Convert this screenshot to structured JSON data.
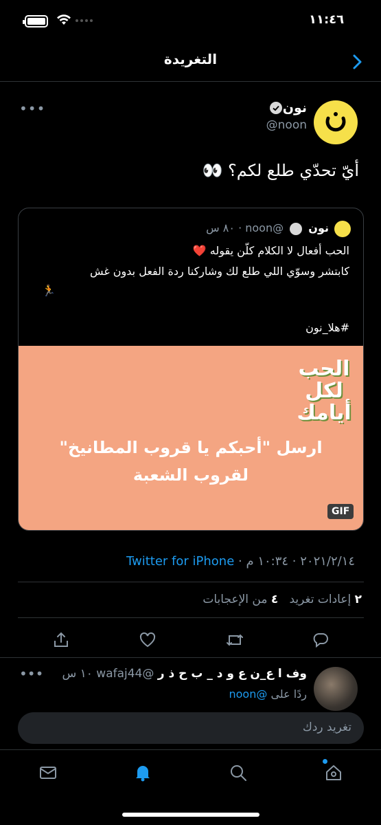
{
  "status_bar": {
    "time": "١١:٤٦"
  },
  "header": {
    "title": "التغريدة"
  },
  "tweet": {
    "author_name": "نون",
    "author_handle": "@noon",
    "text": "أيّ تحدّي طلع لكم؟ 👀",
    "quoted": {
      "author_name": "نون",
      "handle_time": "@noon · ٨٠ س",
      "line1": "الحب أفعال لا الكلام كلّن يقوله ❤️",
      "line2": "كابتشر وسوّي اللي طلع لك وشاركنا ردة الفعل بدون غش",
      "line3": "🏃",
      "hashtag": "#هلا_نون",
      "media_title": "الحب لكل أيامك",
      "media_text_line1": "ارسل \"أحبكم يا قروب المطانيخ\"",
      "media_text_line2": "لقروب الشعبة",
      "gif_label": "GIF"
    },
    "date": "٢٠٢١/٢/١٤ · ١٠:٣٤ م ·",
    "source": "Twitter for iPhone",
    "retweets_count": "٢",
    "retweets_label": "إعادات تغريد",
    "likes_count": "٤",
    "likes_label": "من الإعجابات"
  },
  "reply": {
    "author_name": "وف ا ع_ن ع و د _ ب ح ذ ر",
    "handle_time": "@wafaj44 ١٠ س",
    "replying_prefix": "ردًا على",
    "replying_to": "@noon"
  },
  "composer": {
    "placeholder": "تغريد ردك"
  },
  "colors": {
    "accent": "#1d9bf0",
    "background": "#000000",
    "brand_yellow": "#f6e04a",
    "media_bg": "#f4a582"
  }
}
